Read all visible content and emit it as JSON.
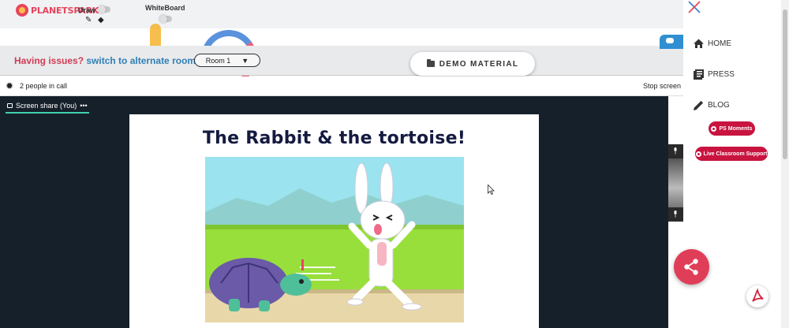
{
  "topbar": {
    "logo_text": "PLANETSPARK",
    "draw_label": "Draw",
    "whiteboard_label": "WhiteBoard"
  },
  "issue_bar": {
    "issue_text": "Having issues?",
    "switch_link": "switch to alternate room",
    "room_value": "Room 1"
  },
  "demo_material_label": "DEMO MATERIAL",
  "call_bar": {
    "people_count": "2 people in call",
    "stop_screen": "Stop screen"
  },
  "screen_share_tab": "Screen share (You)",
  "screen_share_menu": "•••",
  "slide": {
    "title": "The Rabbit & the tortoise!"
  },
  "sidebar": {
    "items": [
      {
        "label": "HOME",
        "icon": "home-icon"
      },
      {
        "label": "PRESS",
        "icon": "press-icon"
      },
      {
        "label": "BLOG",
        "icon": "pencil-icon"
      }
    ],
    "ps_moments": "PS Moments",
    "live_support": "Live Classroom Support"
  },
  "colors": {
    "brand_red": "#e03e58",
    "link_blue": "#2f7fb4",
    "stage_bg": "#16202a",
    "pill_red": "#c8143f"
  }
}
